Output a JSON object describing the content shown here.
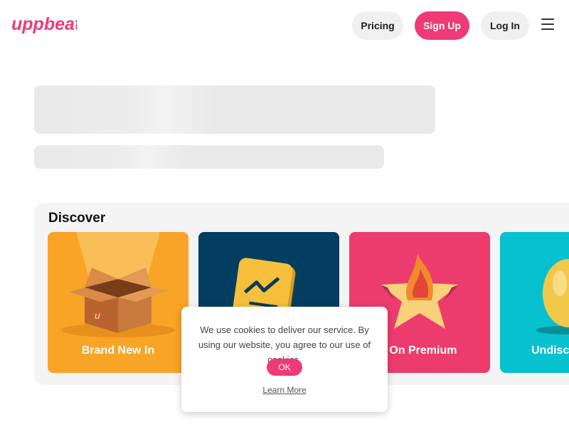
{
  "brand": {
    "logo_text": "Uppbeat",
    "accent_color": "#ee3b76"
  },
  "header": {
    "pricing_label": "Pricing",
    "signup_label": "Sign Up",
    "login_label": "Log In",
    "menu_icon": "hamburger-menu-icon"
  },
  "discover": {
    "title": "Discover",
    "cards": [
      {
        "label": "Brand New In",
        "color": "#f8a427",
        "icon": "open-box-icon"
      },
      {
        "label": "",
        "color": "#023e5f",
        "icon": "trending-chart-icon"
      },
      {
        "label": "t On Premium",
        "color": "#ec3c6e",
        "icon": "flaming-star-icon"
      },
      {
        "label": "Undisc",
        "color": "#07c2ce",
        "icon": "egg-icon"
      }
    ]
  },
  "cookie": {
    "message": "We use cookies to deliver our service. By using our website, you agree to our use of cookies.",
    "ok_label": "OK",
    "learn_more_label": "Learn More"
  }
}
